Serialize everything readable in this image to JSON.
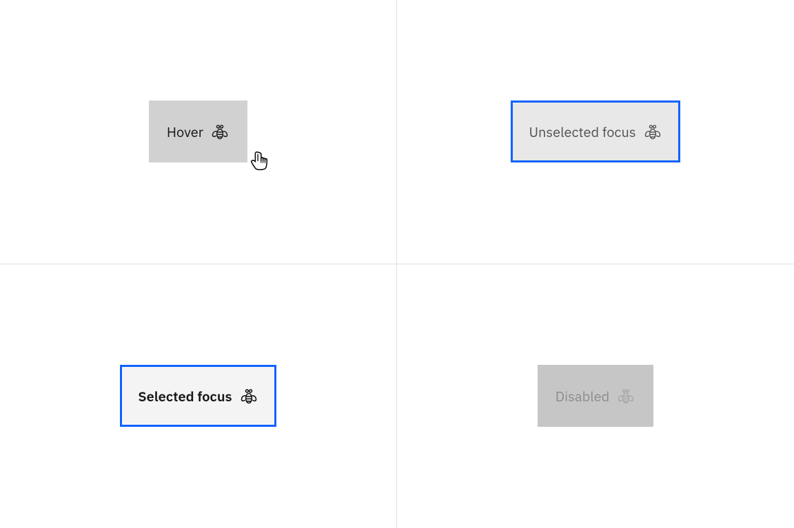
{
  "states": {
    "hover": {
      "label": "Hover"
    },
    "unselected_focus": {
      "label": "Unselected focus"
    },
    "selected_focus": {
      "label": "Selected focus"
    },
    "disabled": {
      "label": "Disabled"
    }
  },
  "colors": {
    "focus_outline": "#0f62fe",
    "hover_bg": "#d1d1d1",
    "unselected_focus_bg": "#e8e8e8",
    "selected_focus_bg": "#f4f4f4",
    "disabled_bg": "#c6c6c6",
    "text_primary": "#161616",
    "text_secondary": "#525252",
    "text_disabled": "#8d8d8d",
    "divider": "#e0e0e0"
  },
  "icon_name": "bee-icon"
}
